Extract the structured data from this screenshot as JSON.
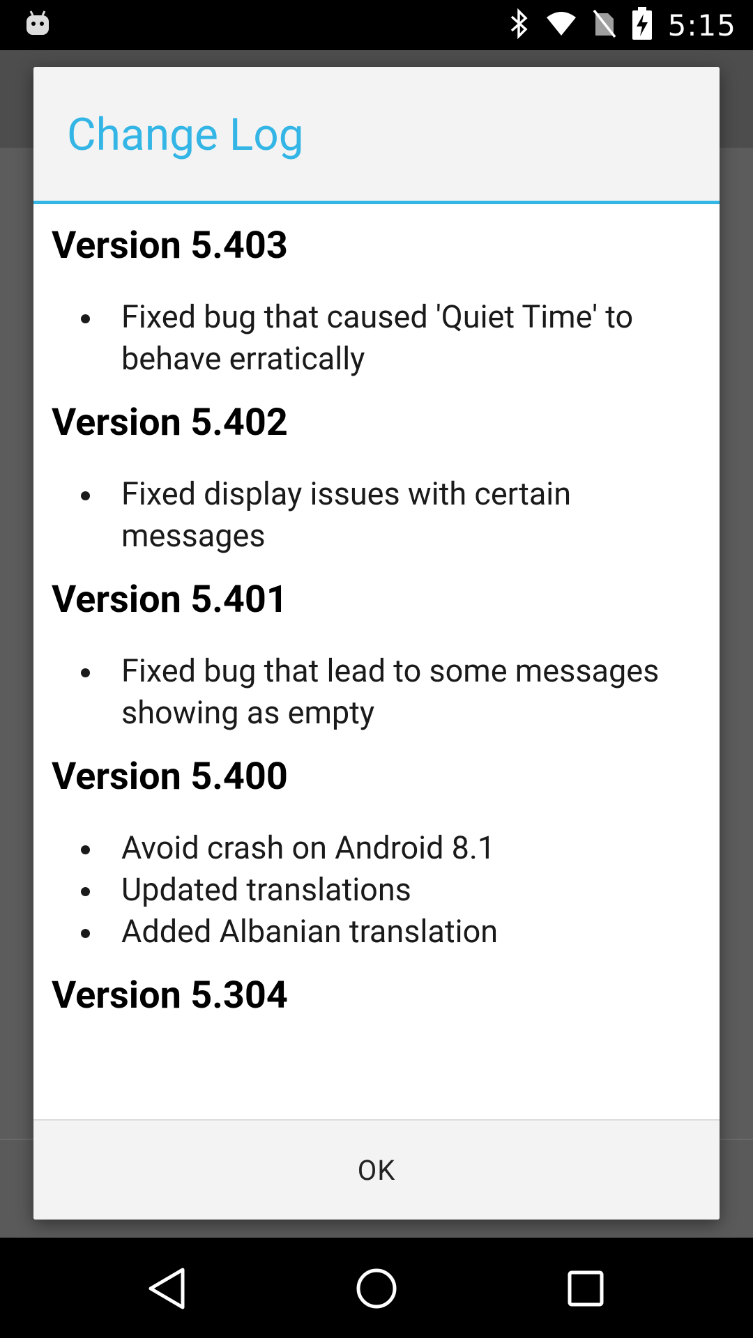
{
  "status_bar": {
    "time": "5:15",
    "icons": [
      "android-debug-icon",
      "bluetooth-icon",
      "wifi-icon",
      "no-sim-icon",
      "battery-charging-icon"
    ]
  },
  "dialog": {
    "title": "Change Log",
    "versions": [
      {
        "heading": "Version 5.403",
        "changes": [
          "Fixed bug that caused 'Quiet Time' to behave erratically"
        ]
      },
      {
        "heading": "Version 5.402",
        "changes": [
          "Fixed display issues with certain messages"
        ]
      },
      {
        "heading": "Version 5.401",
        "changes": [
          "Fixed bug that lead to some messages showing as empty"
        ]
      },
      {
        "heading": "Version 5.400",
        "changes": [
          "Avoid crash on Android 8.1",
          "Updated translations",
          "Added Albanian translation"
        ]
      },
      {
        "heading": "Version 5.304",
        "changes": []
      }
    ],
    "ok_label": "OK"
  },
  "navigation": {
    "buttons": [
      "back-icon",
      "home-icon",
      "recents-icon"
    ]
  },
  "colors": {
    "accent": "#33b5e5",
    "status_bar": "#000000",
    "scrim": "#5f5f5f"
  }
}
